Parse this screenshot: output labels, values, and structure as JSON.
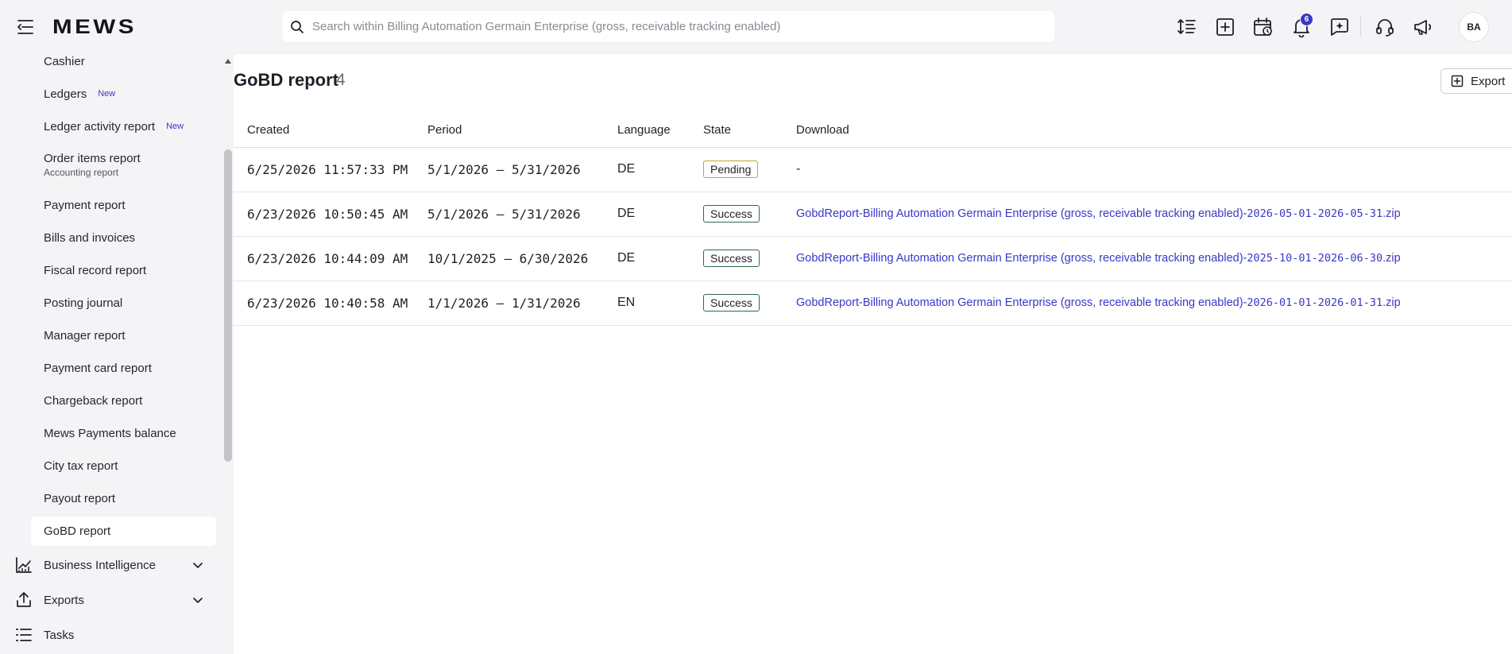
{
  "header": {
    "logo": "MEWS",
    "search_placeholder": "Search within Billing Automation Germain Enterprise (gross, receivable tracking enabled)",
    "notification_count": "6",
    "avatar_initials": "BA"
  },
  "sidebar": {
    "items": [
      {
        "label": "Cashier"
      },
      {
        "label": "Ledgers",
        "tag": "New"
      },
      {
        "label": "Ledger activity report",
        "tag": "New"
      },
      {
        "label": "Order items report",
        "sub": "Accounting report"
      },
      {
        "label": "Payment report"
      },
      {
        "label": "Bills and invoices"
      },
      {
        "label": "Fiscal record report"
      },
      {
        "label": "Posting journal"
      },
      {
        "label": "Manager report"
      },
      {
        "label": "Payment card report"
      },
      {
        "label": "Chargeback report"
      },
      {
        "label": "Mews Payments balance"
      },
      {
        "label": "City tax report"
      },
      {
        "label": "Payout report"
      },
      {
        "label": "GoBD report"
      }
    ],
    "groups": [
      {
        "label": "Business Intelligence",
        "icon": "chart-icon"
      },
      {
        "label": "Exports",
        "icon": "upload-icon"
      },
      {
        "label": "Tasks",
        "icon": "list-icon"
      }
    ]
  },
  "main": {
    "title": "GoBD report",
    "count": "4",
    "export_label": "Export",
    "columns": [
      "Created",
      "Period",
      "Language",
      "State",
      "Download"
    ],
    "rows": [
      {
        "created": "6/25/2026 11:57:33 PM",
        "period": "5/1/2026 – 5/31/2026",
        "language": "DE",
        "state": "Pending",
        "download_name": "",
        "download_dates": "",
        "download_none": "-"
      },
      {
        "created": "6/23/2026 10:50:45 AM",
        "period": "5/1/2026 – 5/31/2026",
        "language": "DE",
        "state": "Success",
        "download_name": "GobdReport-Billing Automation Germain Enterprise (gross, receivable tracking enabled)-",
        "download_dates": "2026-05-01-2026-05-31",
        "download_ext": ".zip"
      },
      {
        "created": "6/23/2026 10:44:09 AM",
        "period": "10/1/2025 – 6/30/2026",
        "language": "DE",
        "state": "Success",
        "download_name": "GobdReport-Billing Automation Germain Enterprise (gross, receivable tracking enabled)-",
        "download_dates": "2025-10-01-2026-06-30",
        "download_ext": ".zip"
      },
      {
        "created": "6/23/2026 10:40:58 AM",
        "period": "1/1/2026 – 1/31/2026",
        "language": "EN",
        "state": "Success",
        "download_name": "GobdReport-Billing Automation Germain Enterprise (gross, receivable tracking enabled)-",
        "download_dates": "2026-01-01-2026-01-31",
        "download_ext": ".zip"
      }
    ]
  },
  "colors": {
    "accent": "#3a37c7",
    "pending_border": "#c7a32a",
    "success_border": "#2e6b4a"
  }
}
